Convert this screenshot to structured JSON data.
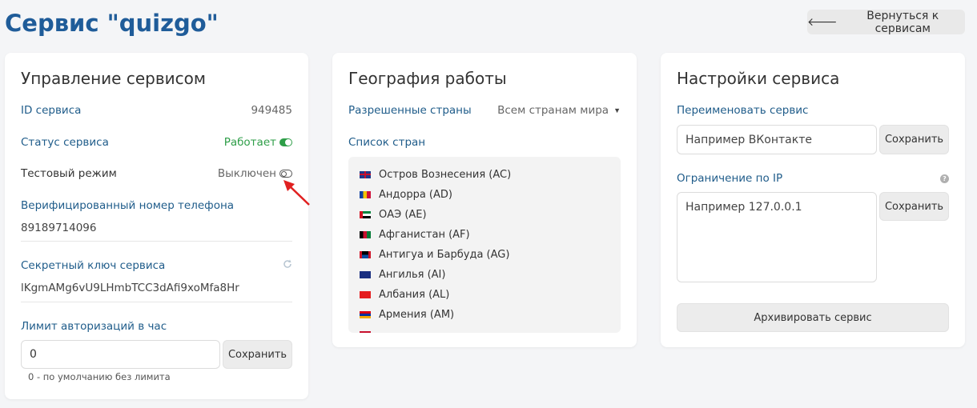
{
  "header": {
    "title": "Сервис \"quizgo\"",
    "back_label": "Вернуться к сервисам"
  },
  "management": {
    "title": "Управление сервисом",
    "id_label": "ID сервиса",
    "id_value": "949485",
    "status_label": "Статус сервиса",
    "status_value": "Работает",
    "test_label": "Тестовый режим",
    "test_value": "Выключен",
    "phone_label": "Верифицированный номер телефона",
    "phone_value": "89189714096",
    "secret_label": "Секретный ключ сервиса",
    "secret_value": "lKgmAMg6vU9LHmbTCC3dAfi9xoMfa8Hr",
    "limit_label": "Лимит авторизаций в час",
    "limit_value": "0",
    "limit_save": "Сохранить",
    "limit_hint": "0 - по умолчанию без лимита"
  },
  "geo": {
    "title": "География работы",
    "allowed_label": "Разрешенные страны",
    "allowed_value": "Всем странам мира",
    "list_label": "Список стран",
    "countries": [
      "Остров Вознесения (AC)",
      "Андорра (AD)",
      "ОАЭ (AE)",
      "Афганистан (AF)",
      "Антигуа и Барбуда (AG)",
      "Ангилья (AI)",
      "Албания (AL)",
      "Армения (AM)"
    ]
  },
  "settings": {
    "title": "Настройки сервиса",
    "rename_label": "Переименовать сервис",
    "rename_placeholder": "Например ВКонтакте",
    "rename_save": "Сохранить",
    "ip_label": "Ограничение по IP",
    "ip_placeholder": "Например 127.0.0.1",
    "ip_save": "Сохранить",
    "archive_label": "Архивировать сервис"
  },
  "colors": {
    "accent": "#1f5c99",
    "status_green": "#2e9e48",
    "annotation_arrow": "#e02020"
  }
}
